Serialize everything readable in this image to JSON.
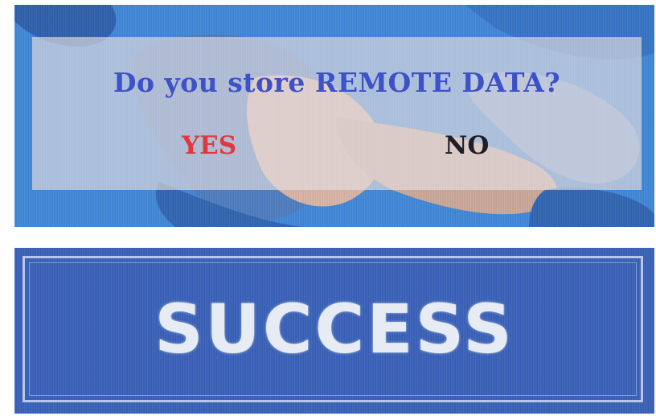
{
  "dialog": {
    "question": "Do you store REMOTE DATA?",
    "yes_label": "YES",
    "no_label": "NO",
    "selected": "YES"
  },
  "result": {
    "message": "SUCCESS"
  },
  "colors": {
    "wallpaper_blue": "#3f86d6",
    "question_text": "#3d51c8",
    "yes_text": "#e0383f",
    "no_text": "#1f1e28",
    "success_background": "#3860b8",
    "success_text": "#e6ebf4"
  }
}
